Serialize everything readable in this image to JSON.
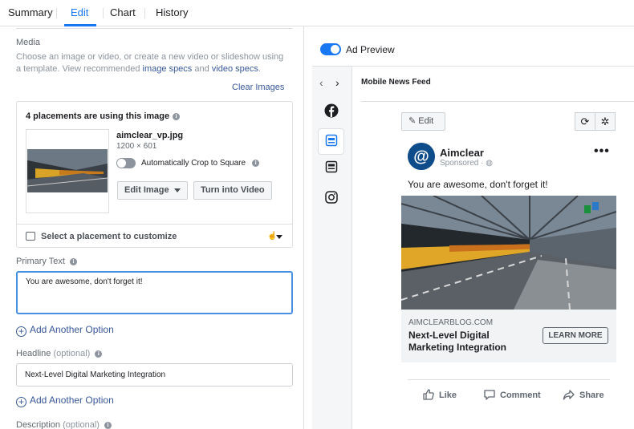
{
  "tabs": [
    {
      "label": "Summary"
    },
    {
      "label": "Edit"
    },
    {
      "label": "Chart"
    },
    {
      "label": "History"
    }
  ],
  "active_tab": "Edit",
  "media": {
    "title": "Media",
    "description_pre": "Choose an image or video, or create a new video or slideshow using a template. View recommended ",
    "image_specs_link": "image specs",
    "and": " and ",
    "video_specs_link": "video specs",
    "period": ".",
    "clear_images": "Clear Images"
  },
  "image_card": {
    "header": "4 placements are using this image",
    "file_name": "aimclear_vp.jpg",
    "dimensions": "1200 × 601",
    "crop_label": "Automatically Crop to Square",
    "crop_enabled": false,
    "edit_image_button": "Edit Image",
    "video_button": "Turn into Video",
    "placement_label": "Select a placement to customize"
  },
  "primary_text": {
    "label": "Primary Text",
    "value": "You are awesome, don't forget it!"
  },
  "add_option_1": "Add Another Option",
  "headline_field": {
    "label": "Headline",
    "optional": "(optional)",
    "value": "Next-Level Digital Marketing Integration"
  },
  "add_option_2": "Add Another Option",
  "description_field": {
    "label": "Description",
    "optional": "(optional)"
  },
  "preview": {
    "toggle_label": "Ad Preview",
    "toggle_on": true,
    "placement_name": "Mobile News Feed",
    "edit_button": "Edit",
    "page_name": "Aimclear",
    "sponsored": "Sponsored ·",
    "post_text": "You are awesome, don't forget it!",
    "link_domain": "AIMCLEARBLOG.COM",
    "link_headline": "Next-Level Digital Marketing Integration",
    "cta": "LEARN MORE",
    "actions": [
      "Like",
      "Comment",
      "Share"
    ]
  },
  "colors": {
    "accent": "#1877f2",
    "link": "#385898",
    "avatar": "#0f4c8a"
  }
}
